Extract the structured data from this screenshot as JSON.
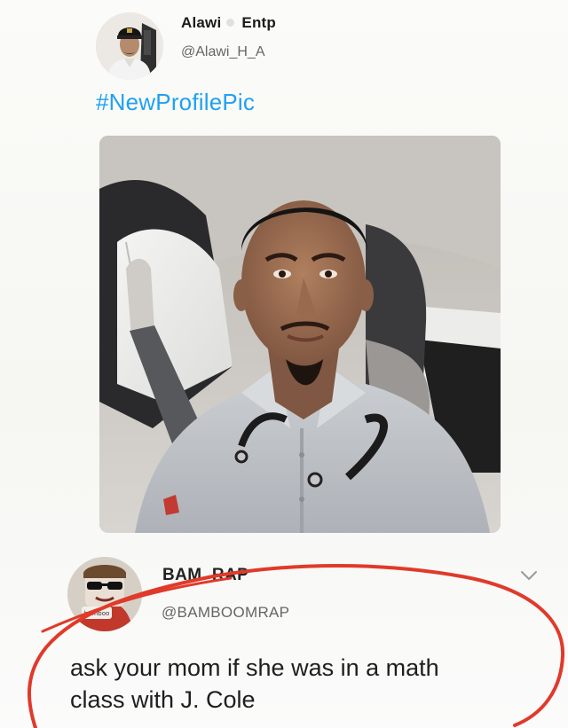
{
  "tweet": {
    "display_name": "Alawi",
    "display_name_suffix": "Entp",
    "handle": "@Alawi_H_A",
    "text": "#NewProfilePic"
  },
  "reply": {
    "display_name": "BAM. RAP",
    "handle": "@BAMBOOMRAP",
    "text_line1": "ask your mom if she was in a math",
    "text_line2": "class with J. Cole",
    "avatar_badge_text": "bamboo"
  },
  "colors": {
    "hashtag": "#1ea1f2",
    "annotation_circle": "#e03a2a",
    "handle_text": "#666666"
  },
  "icons": {
    "more_options": "chevron-down-icon"
  }
}
